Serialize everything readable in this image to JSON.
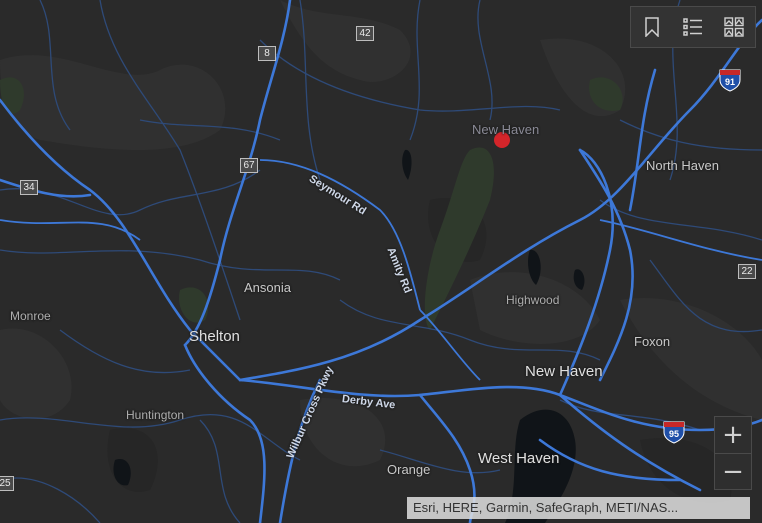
{
  "places": {
    "new_haven_marker": "New Haven",
    "north_haven": "North Haven",
    "ansonia": "Ansonia",
    "shelton": "Shelton",
    "monroe": "Monroe",
    "highwood": "Highwood",
    "new_haven_city": "New Haven",
    "foxon": "Foxon",
    "huntington": "Huntington",
    "orange": "Orange",
    "west_haven": "West Haven"
  },
  "roads": {
    "seymour_rd": "Seymour Rd",
    "amity_rd": "Amity Rd",
    "wilbur_cross": "Wilbur Cross Pkwy",
    "derby_ave": "Derby Ave"
  },
  "shields": {
    "route_42": "42",
    "route_8": "8",
    "route_67": "67",
    "route_34": "34",
    "route_22": "22",
    "route_25": "25",
    "interstate_91": "91",
    "interstate_95": "95"
  },
  "toolbar": {
    "icons": [
      "bookmark-icon",
      "layer-list-icon",
      "basemap-gallery-icon"
    ]
  },
  "zoom": {
    "in_label": "+",
    "out_label": "−"
  },
  "attribution": {
    "text": "Esri, HERE, Garmin, SafeGraph, METI/NAS..."
  },
  "colors": {
    "background": "#2a2a2a",
    "road": "#3d78d8",
    "minor_road": "#2e4a78",
    "water": "#101418",
    "park": "#2f3a2c",
    "marker": "#d4252a"
  }
}
